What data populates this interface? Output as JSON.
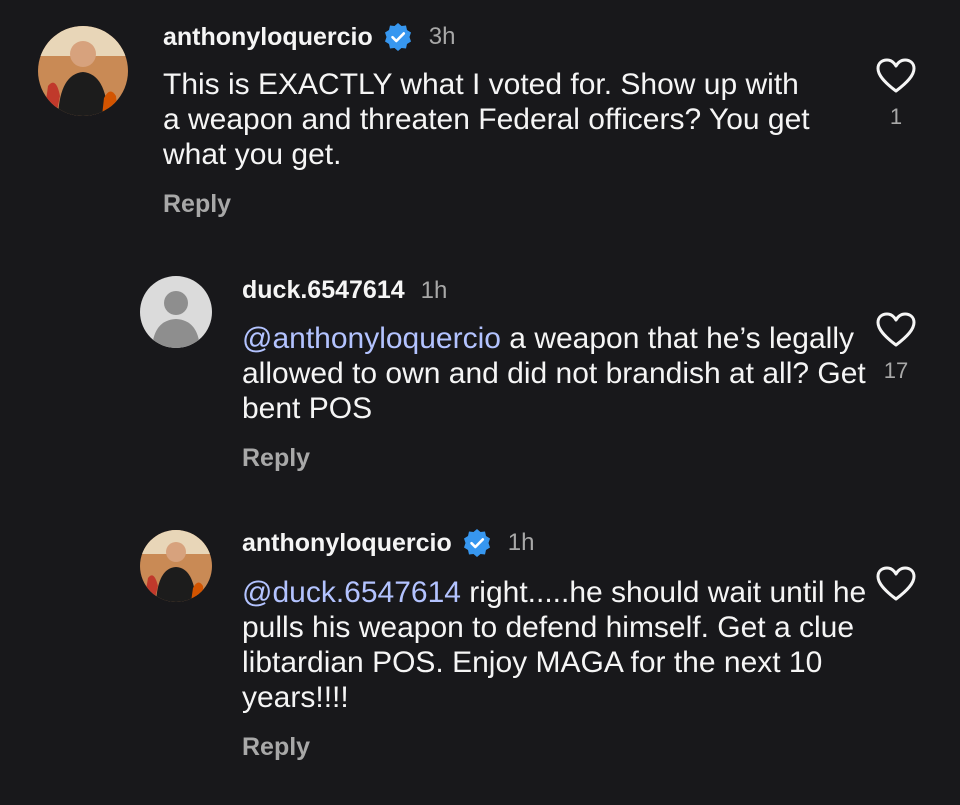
{
  "colors": {
    "background": "#18181b",
    "text": "#f5f5f5",
    "muted": "#a8a8a8",
    "mention": "#b3c3ff",
    "verified": "#3797f0"
  },
  "comments": [
    {
      "username": "anthonyloquercio",
      "verified": true,
      "time": "3h",
      "text": "This is EXACTLY what I voted for.  Show up with a weapon and threaten Federal officers?  You get what you get.",
      "reply_label": "Reply",
      "likes": "1",
      "icon": "heart-outline-icon"
    },
    {
      "username": "duck.6547614",
      "verified": false,
      "time": "1h",
      "mention": "@anthonyloquercio",
      "text": " a weapon that he’s legally allowed to own and did not brandish at all? Get bent POS",
      "reply_label": "Reply",
      "likes": "17",
      "icon": "heart-outline-icon"
    },
    {
      "username": "anthonyloquercio",
      "verified": true,
      "time": "1h",
      "mention": "@duck.6547614",
      "text": " right.....he should wait until he pulls his weapon to defend himself. Get a clue libtardian POS. Enjoy MAGA for the next 10 years!!!!",
      "reply_label": "Reply",
      "likes": "",
      "icon": "heart-outline-icon"
    }
  ]
}
